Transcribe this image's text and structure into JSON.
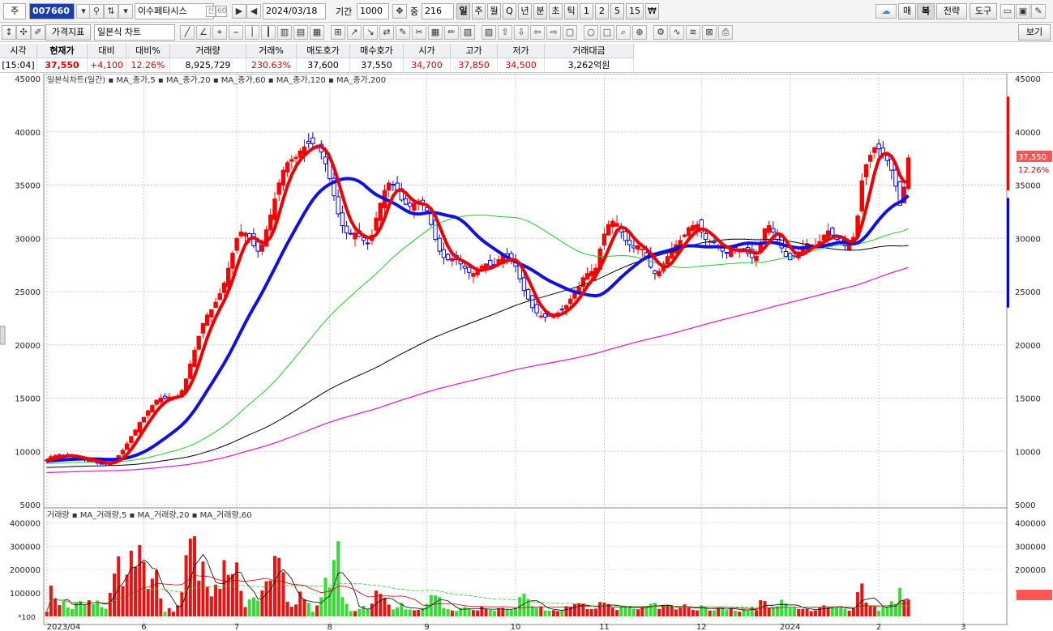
{
  "toolbar": {
    "code_prefix": "주",
    "code": "007660",
    "stock_name": "이수페타시스",
    "badge_credit": "신",
    "badge_margin": "60",
    "date": "2024/03/18",
    "period_label": "기간",
    "period_value": "1000",
    "overlap_label": "중",
    "overlap_value": "216",
    "timeframes": [
      "일",
      "주",
      "월",
      "Q",
      "년",
      "분",
      "초",
      "틱",
      "1",
      "2",
      "5",
      "15",
      "₩"
    ],
    "selected_timeframe": "일",
    "right_buttons": [
      "매",
      "복",
      "전략",
      "도구"
    ],
    "indicator_label": "가격지표",
    "chart_type_label": "일본식 차트",
    "view_label": "보기"
  },
  "info": {
    "headers": [
      "시각",
      "현재가",
      "대비",
      "대비%",
      "거래량",
      "거래%",
      "매도호가",
      "매수호가",
      "시가",
      "고가",
      "저가",
      "거래대금"
    ],
    "values": [
      "[15:04]",
      "37,550",
      "+4,100",
      "12.26%",
      "8,925,729",
      "230.63%",
      "37,600",
      "37,550",
      "34,700",
      "37,850",
      "34,500",
      "3,262억원"
    ]
  },
  "colors": {
    "up": "#ff0000",
    "down": "#0000ff",
    "ma5": "#ee0000",
    "ma20": "#1010e0",
    "ma60": "#22cc22",
    "ma120": "#000000",
    "ma200": "#dd22dd",
    "vol_up": "#ee1111",
    "vol_down": "#33dd33"
  },
  "chart_data": {
    "type": "candlestick",
    "title": "일본식차트(일간)",
    "legend": [
      "MA_종가,5",
      "MA_종가,20",
      "MA_종가,60",
      "MA_종가,120",
      "MA_종가,200"
    ],
    "ylim": [
      5000,
      45000
    ],
    "yticks": [
      5000,
      10000,
      15000,
      20000,
      25000,
      30000,
      35000,
      40000,
      45000
    ],
    "x_labels": [
      "2023/04",
      "6",
      "7",
      "8",
      "9",
      "10",
      "11",
      "12",
      "2024",
      "2",
      "3"
    ],
    "x_label_index": [
      0,
      23,
      45,
      67,
      90,
      111,
      132,
      155,
      176,
      197,
      217
    ],
    "num_days": 227,
    "close": [
      9200,
      9500,
      9600,
      9700,
      9600,
      9550,
      9500,
      9400,
      9300,
      9200,
      9100,
      9000,
      8900,
      8850,
      8800,
      8950,
      9200,
      9600,
      10100,
      10700,
      11400,
      12000,
      12700,
      13200,
      13800,
      14300,
      14800,
      15000,
      15000,
      15100,
      15100,
      15200,
      15700,
      16800,
      18200,
      19500,
      20800,
      22000,
      22800,
      23300,
      24000,
      24800,
      25800,
      27200,
      28600,
      30000,
      30600,
      30500,
      30000,
      29300,
      28800,
      29400,
      30800,
      32200,
      33700,
      35200,
      36400,
      37100,
      37400,
      37600,
      38200,
      38600,
      38900,
      38900,
      38600,
      38100,
      37000,
      35600,
      34000,
      32300,
      31200,
      30500,
      30400,
      30500,
      30200,
      29800,
      29500,
      30300,
      31900,
      33300,
      34500,
      35200,
      35000,
      34400,
      33600,
      33200,
      33000,
      33300,
      33500,
      33200,
      32600,
      31300,
      29900,
      28800,
      28200,
      28000,
      28100,
      28000,
      27600,
      27200,
      26800,
      26700,
      26900,
      27400,
      27600,
      27400,
      27500,
      28000,
      28400,
      28200,
      27900,
      27400,
      26200,
      25100,
      24300,
      23500,
      23000,
      22700,
      22600,
      22700,
      22900,
      23000,
      23300,
      23700,
      24300,
      24800,
      25400,
      26300,
      26700,
      26900,
      27200,
      29000,
      30400,
      31300,
      31600,
      31400,
      30600,
      29800,
      29400,
      29100,
      29300,
      29000,
      28200,
      27300,
      26700,
      26900,
      27600,
      28300,
      29000,
      29400,
      29800,
      30300,
      31000,
      31200,
      31300,
      30600,
      29900,
      29700,
      29600,
      29300,
      28800,
      28600,
      28900,
      29000,
      29000,
      28800,
      28600,
      28200,
      28300,
      29600,
      30900,
      31200,
      30600,
      29900,
      29100,
      28300,
      28000,
      28300,
      28700,
      29200,
      29500,
      29400,
      29300,
      29700,
      30300,
      30700,
      30300,
      29900,
      29600,
      29300,
      29500,
      30100,
      32100,
      35400,
      36900,
      37800,
      38500,
      38400,
      37900,
      37300,
      36400,
      34900,
      33100,
      34800,
      37550
    ]
  }
}
